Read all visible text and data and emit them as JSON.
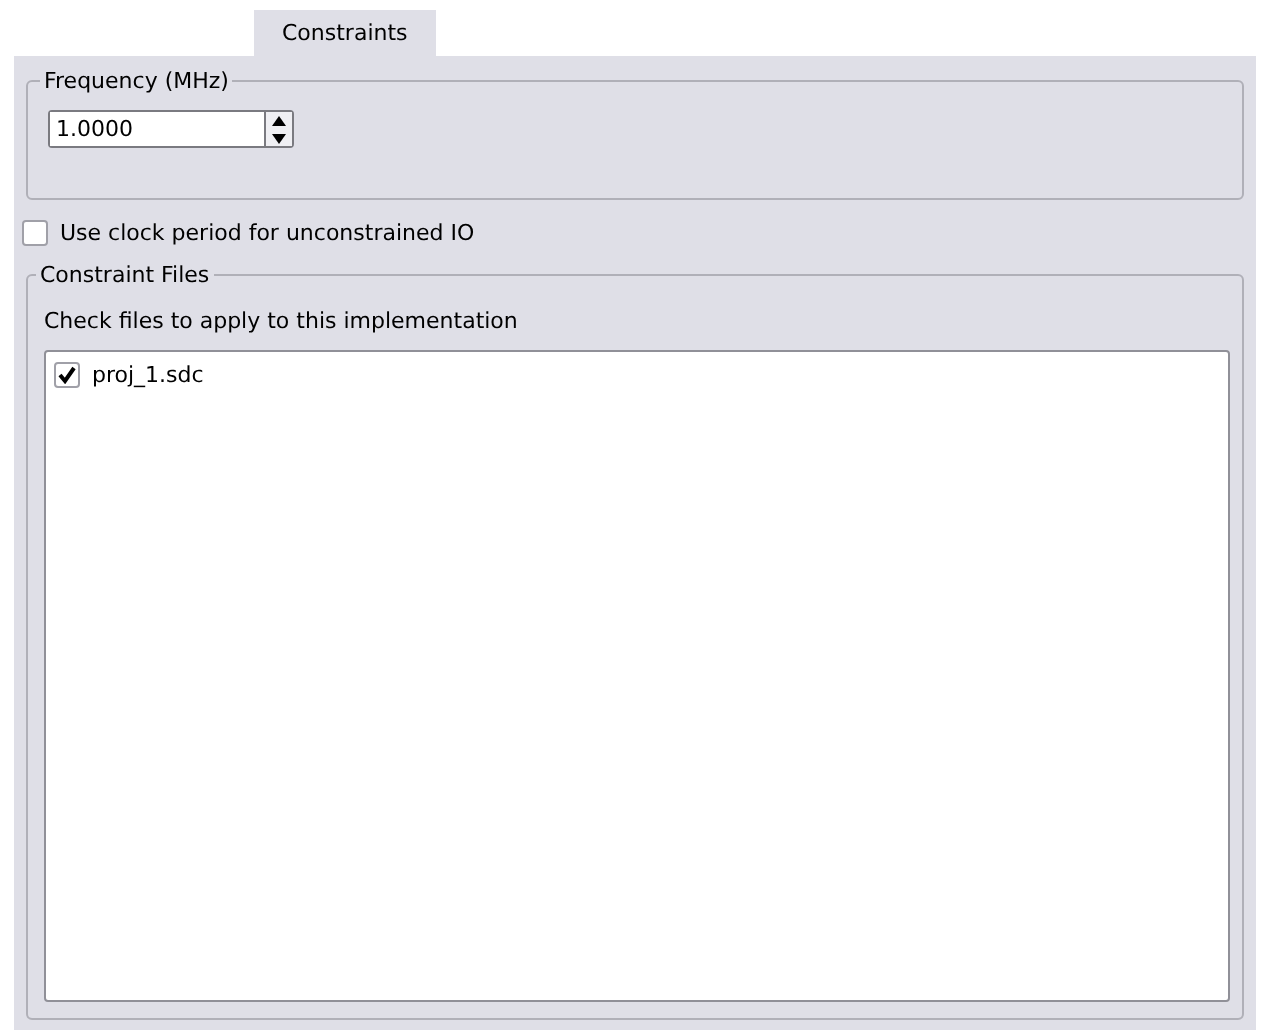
{
  "tabs": [
    {
      "label": "Constraints",
      "selected": true
    }
  ],
  "frequency": {
    "title": "Frequency (MHz)",
    "value": "1.0000"
  },
  "clock_option": {
    "label": "Use clock period for unconstrained IO",
    "checked": false
  },
  "constraint_files": {
    "title": "Constraint Files",
    "hint": "Check files to apply to this implementation",
    "files": [
      {
        "name": "proj_1.sdc",
        "checked": true
      }
    ]
  }
}
